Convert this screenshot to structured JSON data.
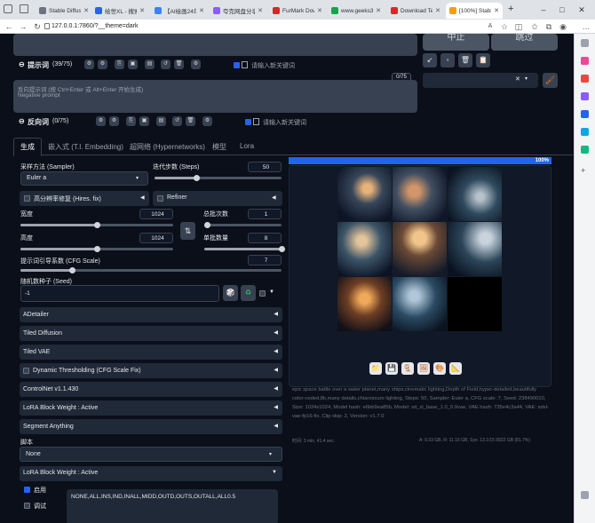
{
  "browser": {
    "tabs": [
      {
        "label": "Stable Diffusi",
        "color": "#6b7280"
      },
      {
        "label": "绘世XL - 搜索",
        "color": "#2563eb"
      },
      {
        "label": "【AI绘画24年",
        "color": "#3b82f6"
      },
      {
        "label": "夸克网盘分享",
        "color": "#8b5cf6"
      },
      {
        "label": "FurMark Dow",
        "color": "#dc2626"
      },
      {
        "label": "www.geeks3d",
        "color": "#16a34a"
      },
      {
        "label": "Download Te",
        "color": "#dc2626"
      },
      {
        "label": "[100%] Stable",
        "color": "#f59e0b"
      }
    ],
    "new_tab": "+",
    "url": "127.0.0.1:7860/?__theme=dark"
  },
  "top_buttons": {
    "interrupt": "中止",
    "skip": "跳过"
  },
  "prompt": {
    "title": "提示词",
    "count": "(39/75)",
    "neg_checkbox_label": "请输入新关键词",
    "style_select_value": "",
    "token_counter": "0/75"
  },
  "negative": {
    "placeholder_line1": "反向提示词 (按 Ctrl+Enter 或 Alt+Enter 开始生成)",
    "placeholder_line2": "Negative prompt",
    "title": "反向词",
    "count": "(0/75)",
    "checkbox_label": "请输入新关键词"
  },
  "tabs": [
    "生成",
    "嵌入式 (T.I. Embedding)",
    "超网络 (Hypernetworks)",
    "模型",
    "Lora"
  ],
  "gen": {
    "sampler_label": "采样方法 (Sampler)",
    "sampler_value": "Euler a",
    "steps_label": "迭代步数 (Steps)",
    "steps_value": "50",
    "steps_fraction": 0.33,
    "hires_label": "高分辨率修复 (Hires. fix)",
    "refiner_label": "Refiner",
    "width_label": "宽度",
    "width_value": "1024",
    "width_fraction": 0.5,
    "height_label": "高度",
    "height_value": "1024",
    "height_fraction": 0.5,
    "swap_icon": "⇅",
    "batch_count_label": "总批次数",
    "batch_count_value": "1",
    "batch_count_fraction": 0.0,
    "batch_size_label": "单批数量",
    "batch_size_value": "8",
    "batch_size_fraction": 1.0,
    "cfg_label": "提示词引导系数 (CFG Scale)",
    "cfg_value": "7",
    "cfg_fraction": 0.2,
    "seed_label": "随机数种子 (Seed)",
    "seed_value": "-1"
  },
  "accordions": [
    "ADetailer",
    "Tiled Diffusion",
    "Tiled VAE",
    "Dynamic Thresholding (CFG Scale Fix)",
    "ControlNet v1.1.430",
    "LoRA Block Weight : Active",
    "Segment Anything"
  ],
  "script": {
    "label": "脚本",
    "value": "None"
  },
  "lbw": {
    "title": "LoRA Block Weight : Active",
    "enable_label": "启用",
    "debug_label": "调试",
    "preset_text": "NONE,ALL,INS,IND,INALL,MIDD,OUTD,OUTS,OUTALL,ALL0.5"
  },
  "output": {
    "progress_text": "100%",
    "progress": 1.0,
    "info_text": "epic space battle over a water planet,many ships,cinematic lighting,Depth of Field,hyper-detailed,beautifully color-coded,8k,many details,chiaroscuro lighting, Steps: 50, Sampler: Euler a, CFG scale: 7, Seed: 238490010, Size: 1024x1024, Model hash: e6bb9ea85b, Model: sd_xl_base_1.0_0.9vae, VAE hash: 735e4c3a44, VAE: sdxl-vae-fp16-fix, Clip skip: 2, Version: v1.7.0",
    "time_text": "时间: 3 min. 41.4 sec.",
    "vram_text": "A: 9.33 GB, R: 11.16 GB, Sys: 13.1/15.9922 GB (81.7%)"
  },
  "colors": {
    "accent": "#2563eb",
    "bg": "#0b0f19",
    "panel": "#1f2937"
  }
}
